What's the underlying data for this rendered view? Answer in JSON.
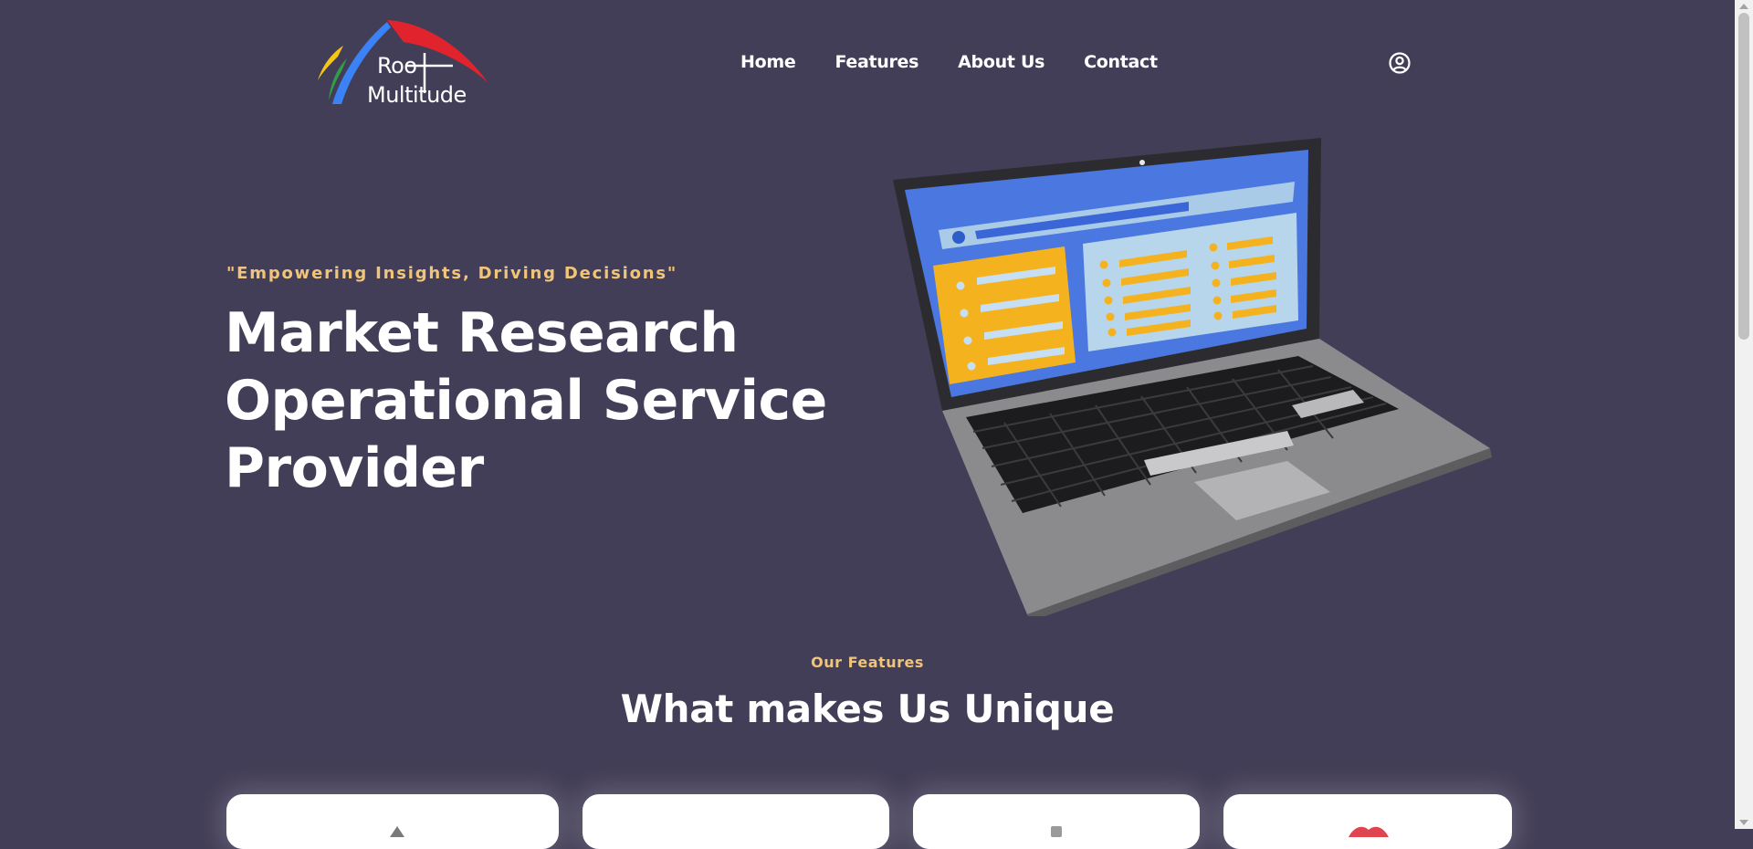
{
  "brand": {
    "logo_line1": "Roo",
    "logo_line2": "Multitude",
    "colors": {
      "red": "#e1232e",
      "blue": "#3b82f6",
      "yellow": "#f5c518",
      "green": "#2f9e44"
    }
  },
  "nav": {
    "items": [
      {
        "label": "Home"
      },
      {
        "label": "Features"
      },
      {
        "label": "About Us"
      },
      {
        "label": "Contact"
      }
    ],
    "user_icon": "user-circle-icon"
  },
  "hero": {
    "tagline": "\"Empowering Insights, Driving Decisions\"",
    "title": "Market Research Operational Service Provider",
    "image": "laptop-dashboard-illustration"
  },
  "features": {
    "label": "Our Features",
    "title": "What makes Us Unique",
    "cards": [
      {
        "icon": "feature-icon-1"
      },
      {
        "icon": "feature-icon-2"
      },
      {
        "icon": "feature-icon-3"
      },
      {
        "icon": "feature-icon-4"
      }
    ]
  },
  "theme": {
    "background": "#433e57",
    "accent": "#f0c57a",
    "text": "#ffffff"
  }
}
